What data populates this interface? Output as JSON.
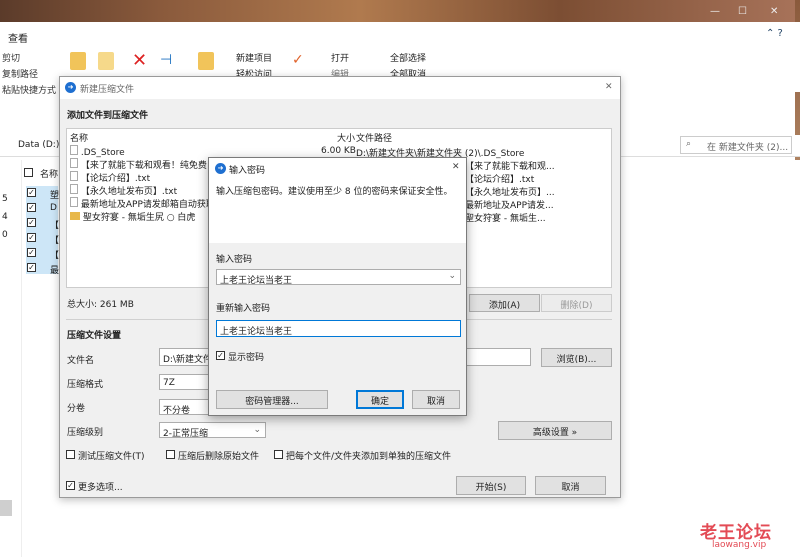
{
  "explorer": {
    "tab": "查看",
    "ribbon_left": [
      "剪切",
      "复制路径",
      "粘贴快捷方式"
    ],
    "new_item": "新建项目",
    "easy_access": "轻松访问",
    "open": "打开",
    "edit": "编辑",
    "select_all": "全部选择",
    "select_none": "全部取消",
    "address": "Data (D:)",
    "search_placeholder": "在 新建文件夹 (2)...",
    "name_header": "名称",
    "left_numbers": [
      "5",
      "4",
      "0"
    ],
    "partial_names": [
      "塑",
      "D",
      "【",
      "【",
      "【",
      "最"
    ]
  },
  "dialog": {
    "title": "新建压缩文件",
    "section_add": "添加文件到压缩文件",
    "col_name": "名称",
    "col_size": "大小",
    "col_path": "文件路径",
    "files": [
      {
        "name": ".DS_Store",
        "size": "6.00 KB",
        "path": "D:\\新建文件夹\\新建文件夹 (2)\\.DS_Store",
        "icon": "file"
      },
      {
        "name": "【来了就能下载和观看！纯免费！",
        "size": "",
        "path": "【来了就能下载和观...",
        "icon": "file"
      },
      {
        "name": "【论坛介绍】.txt",
        "size": "",
        "path": "【论坛介绍】.txt",
        "icon": "file"
      },
      {
        "name": "【永久地址发布页】.txt",
        "size": "",
        "path": "【永久地址发布页】...",
        "icon": "file"
      },
      {
        "name": "最新地址及APP请发邮箱自动获取",
        "size": "",
        "path": "最新地址及APP请发...",
        "icon": "file"
      },
      {
        "name": "聖女狩宴 - 無垢生尻 ○ 白虎",
        "size": "",
        "path": "聖女狩宴 - 無垢生...",
        "icon": "folder"
      }
    ],
    "total_size": "总大小: 261 MB",
    "add_btn": "添加(A)",
    "delete_btn": "删除(D)",
    "section_settings": "压缩文件设置",
    "filename_label": "文件名",
    "filename_value": "D:\\新建文件",
    "browse_btn": "浏览(B)...",
    "format_label": "压缩格式",
    "format_value": "7Z",
    "split_label": "分卷",
    "split_value": "不分卷",
    "level_label": "压缩级别",
    "level_value": "2-正常压缩",
    "advanced_btn": "高级设置 »",
    "test_chk": "测试压缩文件(T)",
    "delete_after_chk": "压缩后删除原始文件",
    "separate_chk": "把每个文件/文件夹添加到单独的压缩文件",
    "more_chk": "更多选项...",
    "start_btn": "开始(S)",
    "cancel_btn": "取消"
  },
  "password": {
    "title": "输入密码",
    "desc": "输入压缩包密码。建议使用至少 8 位的密码来保证安全性。",
    "enter_label": "输入密码",
    "enter_value": "上老王论坛当老王",
    "reenter_label": "重新输入密码",
    "reenter_value": "上老王论坛当老王",
    "show_chk": "显示密码",
    "manager_btn": "密码管理器...",
    "ok_btn": "确定",
    "cancel_btn": "取消"
  },
  "watermark": {
    "big": "老王论坛",
    "small": "laowang.vip"
  }
}
